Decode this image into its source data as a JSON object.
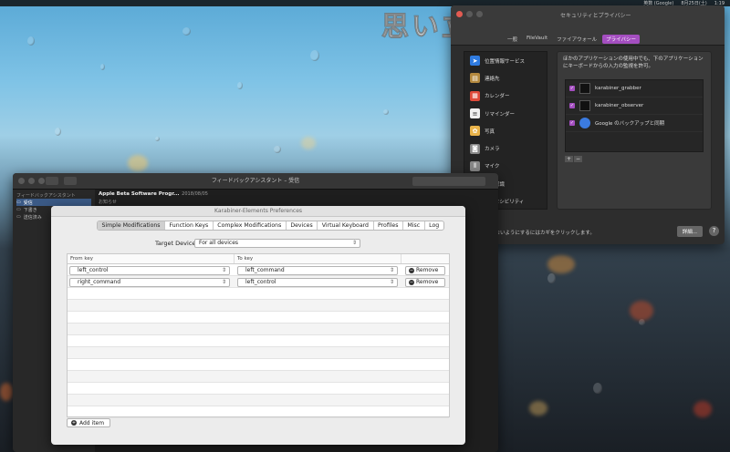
{
  "menubar": {
    "items": [
      "英数 (Google)",
      "8月25日(土)",
      "1:19"
    ]
  },
  "overlay_title": "思い立ったが吉日！",
  "security_window": {
    "title": "セキュリティとプライバシー",
    "tabs": [
      {
        "label": "一般"
      },
      {
        "label": "FileVault"
      },
      {
        "label": "ファイアウォール"
      },
      {
        "label": "プライバシー"
      }
    ],
    "sidebar": [
      {
        "label": "位置情報サービス",
        "icon": "location-icon",
        "color": "#2f7be0"
      },
      {
        "label": "連絡先",
        "icon": "contacts-icon",
        "color": "#b4893e"
      },
      {
        "label": "カレンダー",
        "icon": "calendar-icon",
        "color": "#e04a3a"
      },
      {
        "label": "リマインダー",
        "icon": "reminders-icon",
        "color": "#f0f0f0"
      },
      {
        "label": "写真",
        "icon": "photos-icon",
        "color": "#e9b34a"
      },
      {
        "label": "カメラ",
        "icon": "camera-icon",
        "color": "#888888"
      },
      {
        "label": "マイク",
        "icon": "microphone-icon",
        "color": "#888888"
      },
      {
        "label": "音声認識",
        "icon": "speech-icon",
        "color": "#888888"
      },
      {
        "label": "アクセシビリティ",
        "icon": "accessibility-icon",
        "color": "#2f7be0"
      }
    ],
    "description": "ほかのアプリケーションの使用中でも、下のアプリケーションにキーボードからの入力の監視を許可。",
    "apps": [
      {
        "label": "karabiner_grabber",
        "checked": true
      },
      {
        "label": "karabiner_observer",
        "checked": true
      },
      {
        "label": "Google のバックアップと同期",
        "checked": true
      }
    ],
    "lock_text": "変更できないようにするにはカギをクリックします。",
    "advanced_label": "詳細...",
    "help_label": "?"
  },
  "feedback_window": {
    "title": "フィードバックアシスタント – 受信",
    "sidebar_header": "フィードバックアシスタント",
    "sidebar_items": [
      "受信",
      "下書き",
      "送信済み"
    ],
    "message_title": "Apple Beta Software Progr...",
    "message_date": "2018/08/05",
    "message_sub": "お知らせ"
  },
  "karabiner_window": {
    "title": "Karabiner-Elements Preferences",
    "tabs": [
      {
        "label": "Simple Modifications",
        "active": true
      },
      {
        "label": "Function Keys"
      },
      {
        "label": "Complex Modifications"
      },
      {
        "label": "Devices"
      },
      {
        "label": "Virtual Keyboard"
      },
      {
        "label": "Profiles"
      },
      {
        "label": "Misc"
      },
      {
        "label": "Log"
      }
    ],
    "target_label": "Target Device:",
    "target_value": "For all devices",
    "col_from": "From key",
    "col_to": "To key",
    "rows": [
      {
        "from": "left_control",
        "to": "left_command"
      },
      {
        "from": "right_command",
        "to": "left_control"
      }
    ],
    "remove_label": "Remove",
    "add_label": "Add item"
  },
  "colors": {
    "accent": "#a44ec0",
    "desktop_top": "#5aa9d6",
    "desktop_bottom": "#1a1f25"
  }
}
